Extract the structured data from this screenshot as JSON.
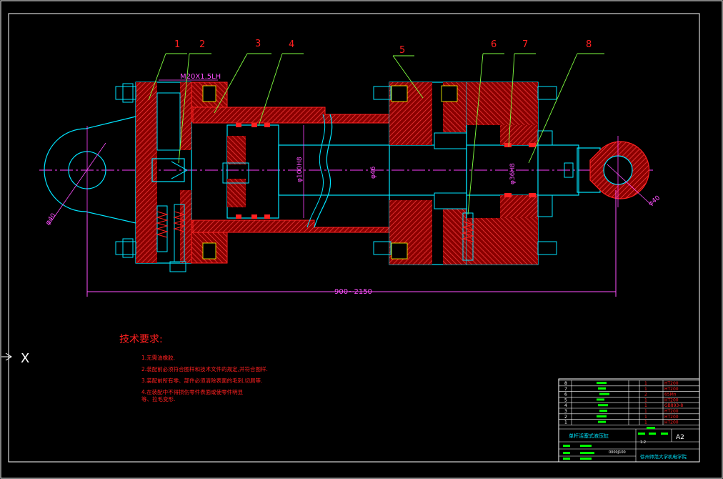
{
  "drawing": {
    "balloons": [
      "1",
      "2",
      "3",
      "4",
      "5",
      "6",
      "7",
      "8"
    ],
    "thread_callout": "M20X1.5LH",
    "dim_overall": "900~2150",
    "dim_left_eye": "φ40",
    "dim_right_eye": "φ40",
    "dim_bore": "φ100H8",
    "dim_rod": "φ46",
    "dim_rod_seal": "φ36H8"
  },
  "tech": {
    "heading": "技术要求:",
    "items": [
      "1.无需油橡胶.",
      "2.装配前必须符合图样和技术文件的规定,并符合图样.",
      "3.装配前所有零、部件必须清除表面的毛刺,切屑等.",
      "4.在装配中不得损伤零件表面或使零件明显",
      "等、拉毛变形."
    ]
  },
  "title_block": {
    "rows": [
      {
        "no": "8",
        "qty": "1",
        "mat": "HT200"
      },
      {
        "no": "7",
        "qty": "1",
        "mat": "HT200"
      },
      {
        "no": "6",
        "qty": "2",
        "mat": "65Mn"
      },
      {
        "no": "5",
        "qty": "1",
        "mat": "HT200"
      },
      {
        "no": "4",
        "qty": "1",
        "mat": "GB893-8"
      },
      {
        "no": "3",
        "qty": "1",
        "mat": "HT200"
      },
      {
        "no": "2",
        "qty": "1",
        "mat": "HT200"
      },
      {
        "no": "1",
        "qty": "1",
        "mat": "HT200"
      }
    ],
    "drawing_name": "单杆活塞式液压缸",
    "sheet_size": "A2",
    "scale": "1:2",
    "code": "0000J100",
    "school": "徐州师范大学机电学院"
  },
  "ucs_label": "X",
  "colors": {
    "background": "#000000",
    "outline": "#00e5ff",
    "section": "#ff2020",
    "hatch": "#ff3030",
    "centerline": "#ff40ff",
    "leader": "#80ff40",
    "border": "#ffffff",
    "dimension": "#ff50ff",
    "text_red": "#ff3030",
    "yellow": "#ffff00",
    "green": "#00ff00"
  }
}
